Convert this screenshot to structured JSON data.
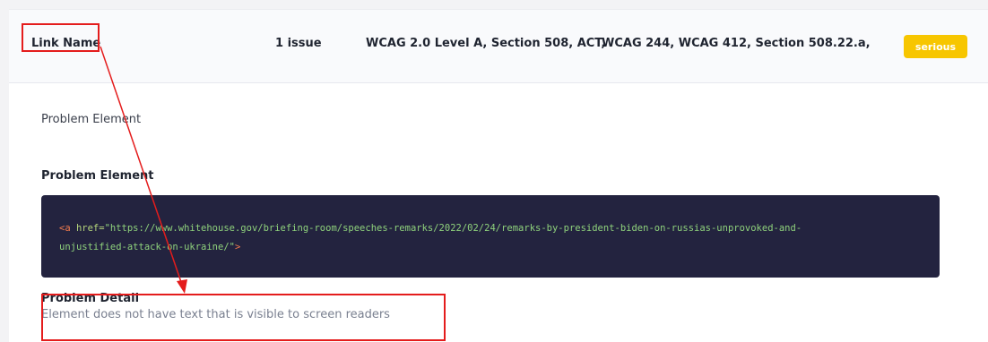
{
  "rule": {
    "name": "Link Name",
    "issue_count": "1 issue",
    "criteria_primary": "WCAG 2.0 Level A, Section 508, ACT,",
    "criteria_secondary": "WCAG 244, WCAG 412, Section 508.22.a,",
    "severity": "serious"
  },
  "problem_element_heading": "Problem Element",
  "problem_element_subheading": "Problem Element",
  "code": {
    "open": "<a ",
    "attr": "href=",
    "value": "\"https://www.whitehouse.gov/briefing-room/speeches-remarks/2022/02/24/remarks-by-president-biden-on-russias-unprovoked-and-",
    "value_cont": "unjustified-attack-on-ukraine/\"",
    "close": ">"
  },
  "problem_detail": {
    "title": "Problem Detail",
    "text": "Element does not have text that is visible to screen readers"
  },
  "colors": {
    "badge": "#f7c600",
    "annotation": "#e41c1c",
    "code_bg": "#23233f"
  }
}
